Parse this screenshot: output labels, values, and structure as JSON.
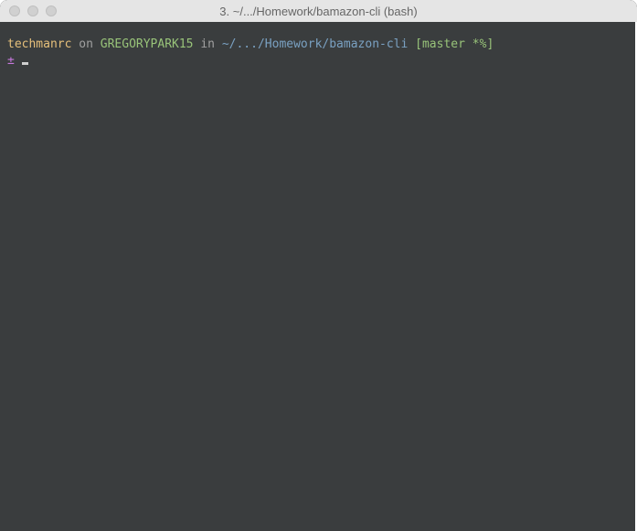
{
  "titlebar": {
    "title": "3. ~/.../Homework/bamazon-cli (bash)"
  },
  "prompt": {
    "user": "techmanrc",
    "on": " on ",
    "host": "GREGORYPARK15",
    "in": " in ",
    "path": "~/.../Homework/bamazon-cli",
    "branch_open": " [",
    "branch": "master *%",
    "branch_close": "]",
    "symbol": "±",
    "space": " "
  }
}
